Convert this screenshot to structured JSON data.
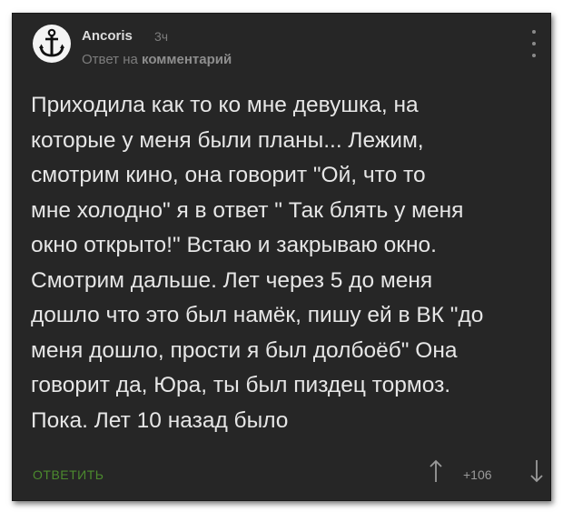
{
  "comment": {
    "author": "Ancoris",
    "time": "3ч",
    "reply_prefix": "Ответ на",
    "reply_target": "комментарий",
    "text": "Приходила как то ко мне девушка, на\nкоторые у меня были планы... Лежим,\nсмотрим кино, она говорит \"Ой, что то\nмне холодно\" я в ответ \" Так блять у меня\nокно открыто!\" Встаю и закрываю окно.\nСмотрим дальше. Лет через 5 до меня\nдошло что это был намёк, пишу ей в ВК \"до\nменя дошло, прости я был долбоёб\" Она\nговорит да, Юра, ты был пиздец тормоз.\nПока. Лет 10 назад было",
    "reply_button": "ОТВЕТИТЬ",
    "score": "+106"
  },
  "icons": {
    "avatar": "anchor-icon",
    "menu": "more-vertical-icon",
    "upvote": "arrow-up-icon",
    "downvote": "arrow-down-icon"
  },
  "colors": {
    "background": "#262626",
    "text": "#e6e6e6",
    "muted": "#7d7d7d",
    "reply_button": "#4c8a2e"
  }
}
